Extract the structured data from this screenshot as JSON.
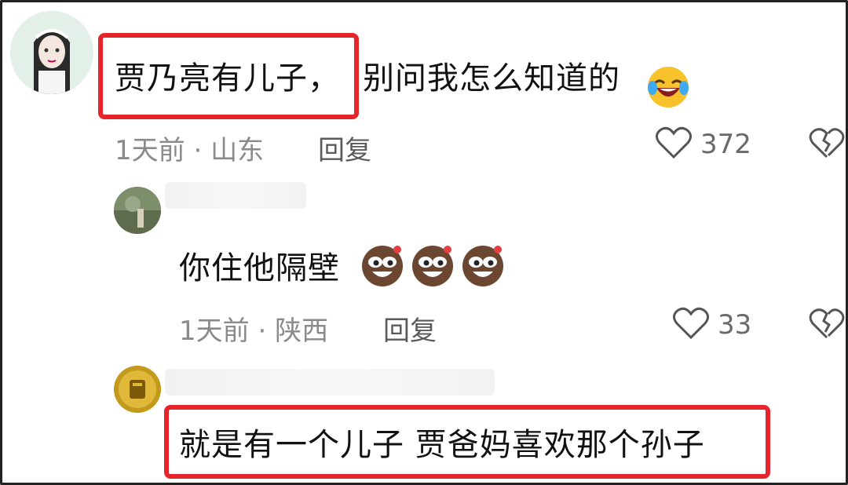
{
  "comments": [
    {
      "text_highlighted": "贾乃亮有儿子，",
      "text_rest": "别问我怎么知道的",
      "emoji": "laughing-crying-emoji",
      "time": "1天前",
      "sep": "·",
      "location": "山东",
      "reply_label": "回复",
      "likes": "372",
      "highlight_color": "#e5252b"
    },
    {
      "text": "你住他隔壁",
      "emojis": [
        "smug-face-emoji",
        "smug-face-emoji",
        "smug-face-emoji"
      ],
      "time": "1天前",
      "sep": "·",
      "location": "陕西",
      "reply_label": "回复",
      "likes": "33"
    },
    {
      "text": "就是有一个儿子 贾爸妈喜欢那个孙子"
    }
  ]
}
